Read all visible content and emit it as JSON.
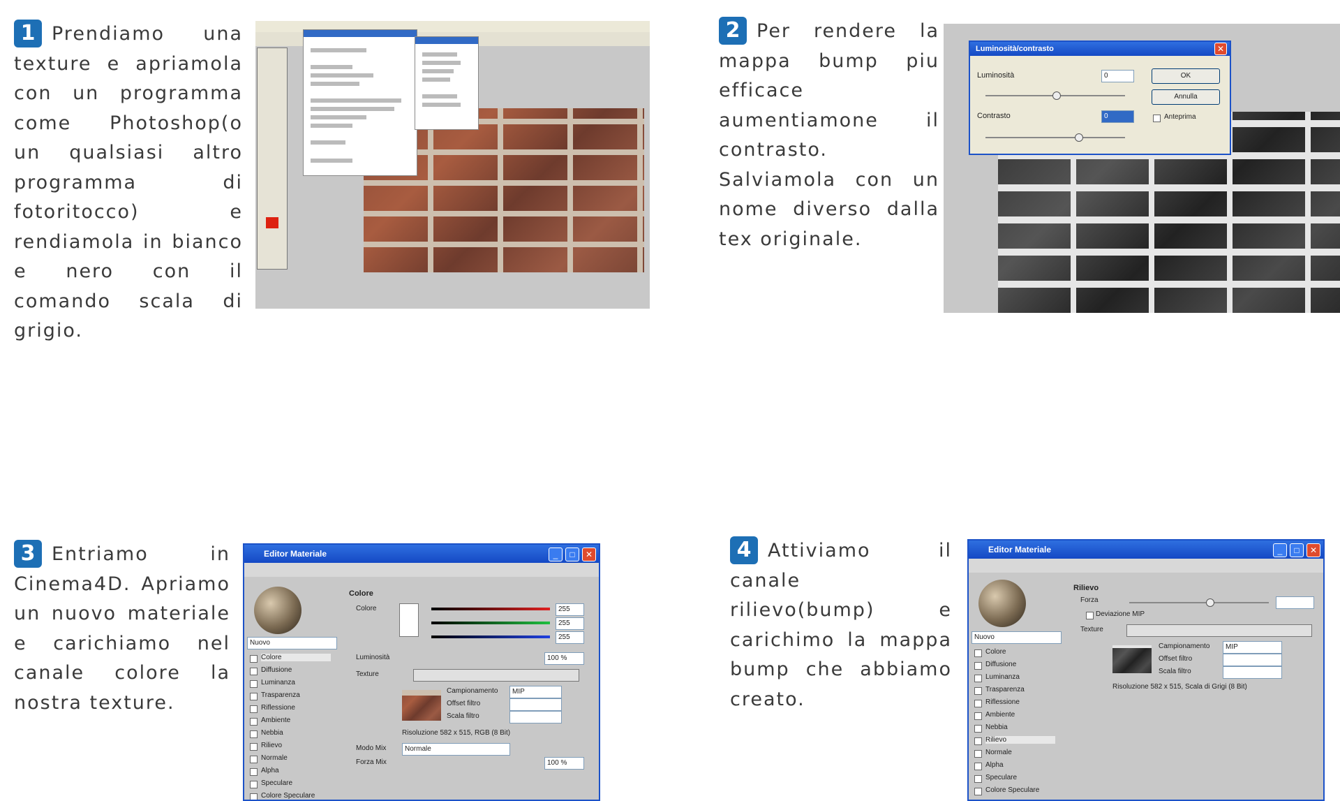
{
  "steps": [
    {
      "number": "1",
      "lines": [
        "Prendiamo una texture e apriamola con un programma come Photoshop(o un qualsiasi altro programma di fotoritocco) e rendiamola in bianco e nero con il comando scala di grigio."
      ]
    },
    {
      "number": "2",
      "lines": [
        "Per rendere la mappa bump piu efficace aumentiamone il contrasto.",
        "Salviamola con un nome diverso dalla tex originale."
      ]
    },
    {
      "number": "3",
      "lines": [
        "Entriamo in Cinema4D. Apriamo un nuovo materiale e carichiamo nel canale colore la nostra texture."
      ]
    },
    {
      "number": "4",
      "lines": [
        "Attiviamo il canale rilievo(bump) e carichimo la mappa bump che abbiamo creato."
      ]
    }
  ],
  "screenshot2": {
    "dialog_title": "Luminosità/contrasto",
    "luminosity_label": "Luminosità",
    "luminosity_value": "0",
    "contrast_label": "Contrasto",
    "contrast_value": "0",
    "ok_label": "OK",
    "cancel_label": "Annulla",
    "preview_label": "Anteprima"
  },
  "screenshot3": {
    "window_title": "Editor Materiale",
    "material_name": "Nuovo",
    "section_title": "Colore",
    "channels": [
      "Colore",
      "Diffusione",
      "Luminanza",
      "Trasparenza",
      "Riflessione",
      "Ambiente",
      "Nebbia",
      "Rilievo",
      "Normale",
      "Alpha",
      "Speculare",
      "Colore Speculare"
    ],
    "color_label": "Colore",
    "rgb_values": [
      "255",
      "255",
      "255"
    ],
    "brightness_label": "Luminosità",
    "brightness_value": "100 %",
    "texture_label": "Texture",
    "sampling_label": "Campionamento",
    "sampling_value": "MIP",
    "offset_label": "Offset filtro",
    "scale_label": "Scala filtro",
    "resolution_text": "Risoluzione 582 x 515, RGB (8 Bit)",
    "mix_mode_label": "Modo Mix",
    "mix_mode_value": "Normale",
    "mix_strength_label": "Forza Mix",
    "mix_strength_value": "100 %"
  },
  "screenshot4": {
    "window_title": "Editor Materiale",
    "material_name": "Nuovo",
    "section_title": "Rilievo",
    "channels": [
      "Colore",
      "Diffusione",
      "Luminanza",
      "Trasparenza",
      "Riflessione",
      "Ambiente",
      "Nebbia",
      "Rilievo",
      "Normale",
      "Alpha",
      "Speculare",
      "Colore Speculare"
    ],
    "strength_label": "Forza",
    "mip_label": "Deviazione MIP",
    "texture_label": "Texture",
    "sampling_label": "Campionamento",
    "sampling_value": "MIP",
    "offset_label": "Offset filtro",
    "scale_label": "Scala filtro",
    "resolution_text": "Risoluzione 582 x 515, Scala di Grigi (8 Bit)"
  }
}
